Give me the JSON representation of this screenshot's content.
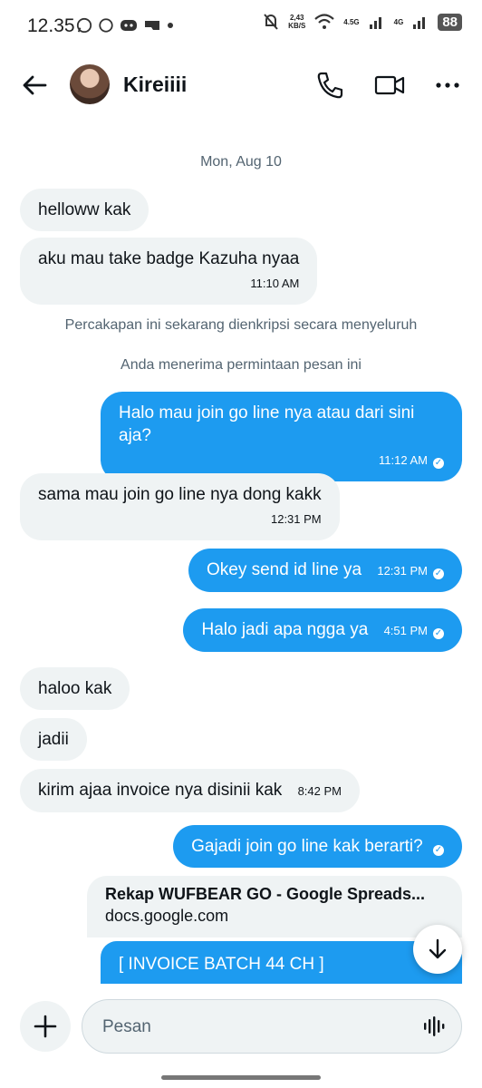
{
  "status": {
    "time": "12.35",
    "netspeed_value": "2,43",
    "netspeed_unit": "KB/S",
    "net1": "4.5G",
    "net2": "4G",
    "battery": "88"
  },
  "header": {
    "contact_name": "Kireiiii"
  },
  "chat": {
    "date": "Mon, Aug 10",
    "system1": "Percakapan ini sekarang dienkripsi secara menyeluruh",
    "system2": "Anda menerima permintaan pesan ini",
    "msgs": {
      "m1": {
        "text": "helloww kak"
      },
      "m2": {
        "text": "aku mau take badge Kazuha nyaa",
        "time": "11:10 AM"
      },
      "m3": {
        "text": "Halo mau join go line nya atau dari sini aja?",
        "time": "11:12 AM"
      },
      "m4": {
        "text": "sama mau join go line nya dong kakk",
        "time": "12:31 PM"
      },
      "m5": {
        "text": "Okey send id line ya",
        "time": "12:31 PM"
      },
      "m6": {
        "text": "Halo jadi apa ngga ya",
        "time": "4:51 PM"
      },
      "m7": {
        "text": "haloo kak"
      },
      "m8": {
        "text": "jadii"
      },
      "m9": {
        "text": "kirim ajaa invoice nya disinii kak",
        "time": "8:42 PM"
      },
      "m10": {
        "text": "Gajadi join go line kak berarti?"
      }
    },
    "link_card": {
      "title": "Rekap WUFBEAR GO - Google Spreads...",
      "domain": "docs.google.com"
    },
    "invoice": "[ INVOICE BATCH 44 CH ]"
  },
  "composer": {
    "placeholder": "Pesan"
  },
  "colors": {
    "outgoing": "#1d9bf0",
    "incoming": "#eff3f4"
  }
}
